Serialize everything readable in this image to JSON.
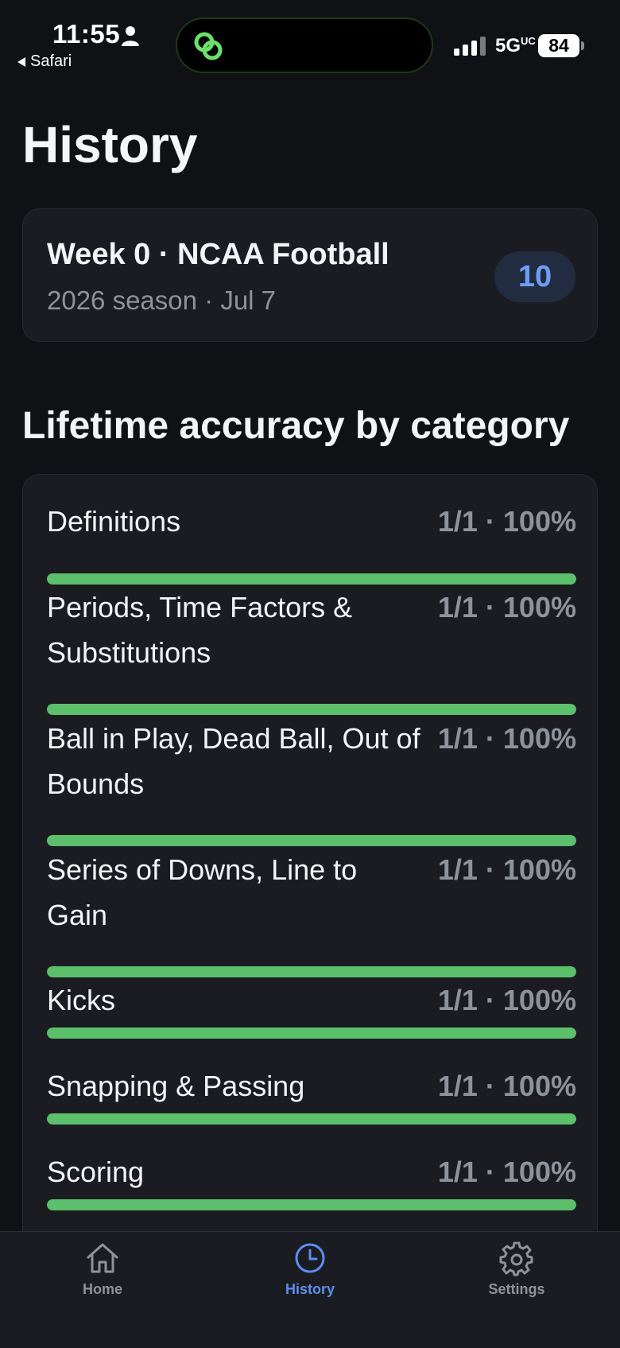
{
  "status_bar": {
    "time": "11:55",
    "back_label": "Safari",
    "network": "5G",
    "network_sup": "UC",
    "battery": "84"
  },
  "page": {
    "title": "History"
  },
  "week_card": {
    "title": "Week 0 · NCAA Football",
    "subtitle": "2026 season · Jul 7",
    "badge": "10"
  },
  "section": {
    "heading": "Lifetime accuracy by category"
  },
  "categories": [
    {
      "label": "Definitions",
      "stat": "1/1 · 100%",
      "progress": 1.0
    },
    {
      "label": "Periods, Time Factors & Substitutions",
      "stat": "1/1 · 100%",
      "progress": 1.0
    },
    {
      "label": "Ball in Play, Dead Ball, Out of Bounds",
      "stat": "1/1 · 100%",
      "progress": 1.0
    },
    {
      "label": "Series of Downs, Line to Gain",
      "stat": "1/1 · 100%",
      "progress": 1.0
    },
    {
      "label": "Kicks",
      "stat": "1/1 · 100%",
      "progress": 1.0
    },
    {
      "label": "Snapping & Passing",
      "stat": "1/1 · 100%",
      "progress": 1.0
    },
    {
      "label": "Scoring",
      "stat": "1/1 · 100%",
      "progress": 1.0
    }
  ],
  "tabs": [
    {
      "label": "Home",
      "icon": "house-icon",
      "active": false
    },
    {
      "label": "History",
      "icon": "clock-icon",
      "active": true
    },
    {
      "label": "Settings",
      "icon": "gear-icon",
      "active": false
    }
  ],
  "colors": {
    "background": "#101115",
    "card": "#1a1c21",
    "accent": "#5c8ef0",
    "progress": "#5cbf6b",
    "muted_text": "#8e929b"
  }
}
